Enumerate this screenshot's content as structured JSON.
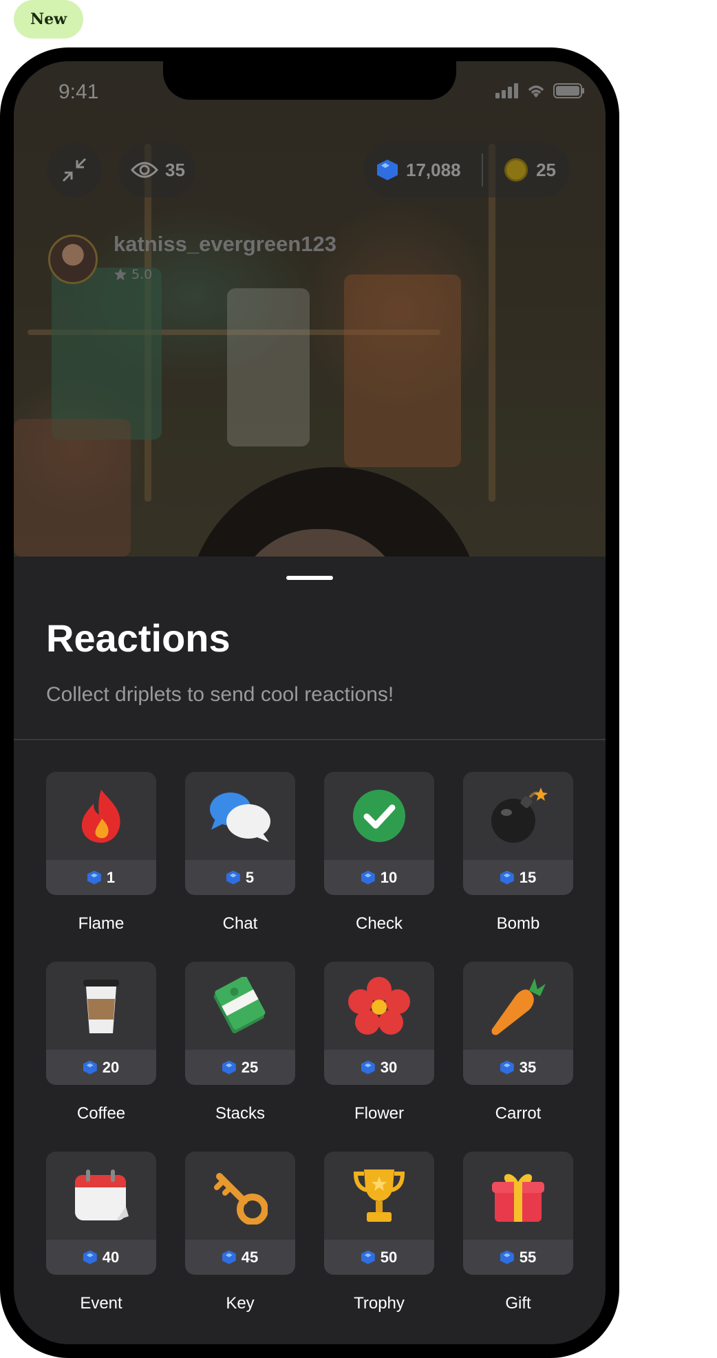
{
  "badge": {
    "label": "New"
  },
  "status_bar": {
    "time": "9:41"
  },
  "stream": {
    "viewers": "35",
    "gems": "17,088",
    "coins": "25",
    "username": "katniss_evergreen123",
    "rating": "5.0"
  },
  "sheet": {
    "title": "Reactions",
    "subtitle": "Collect driplets to send cool reactions!",
    "items": [
      {
        "name": "Flame",
        "price": "1",
        "icon": "flame-icon"
      },
      {
        "name": "Chat",
        "price": "5",
        "icon": "chat-icon"
      },
      {
        "name": "Check",
        "price": "10",
        "icon": "check-icon"
      },
      {
        "name": "Bomb",
        "price": "15",
        "icon": "bomb-icon"
      },
      {
        "name": "Coffee",
        "price": "20",
        "icon": "coffee-icon"
      },
      {
        "name": "Stacks",
        "price": "25",
        "icon": "money-stack-icon"
      },
      {
        "name": "Flower",
        "price": "30",
        "icon": "flower-icon"
      },
      {
        "name": "Carrot",
        "price": "35",
        "icon": "carrot-icon"
      },
      {
        "name": "Event",
        "price": "40",
        "icon": "calendar-icon"
      },
      {
        "name": "Key",
        "price": "45",
        "icon": "key-icon"
      },
      {
        "name": "Trophy",
        "price": "50",
        "icon": "trophy-icon"
      },
      {
        "name": "Gift",
        "price": "55",
        "icon": "gift-icon"
      }
    ]
  },
  "colors": {
    "sheet_bg": "#232325",
    "card_bg": "#353538",
    "gem_blue": "#2f6ee0",
    "badge_green": "#d4f2b0"
  }
}
